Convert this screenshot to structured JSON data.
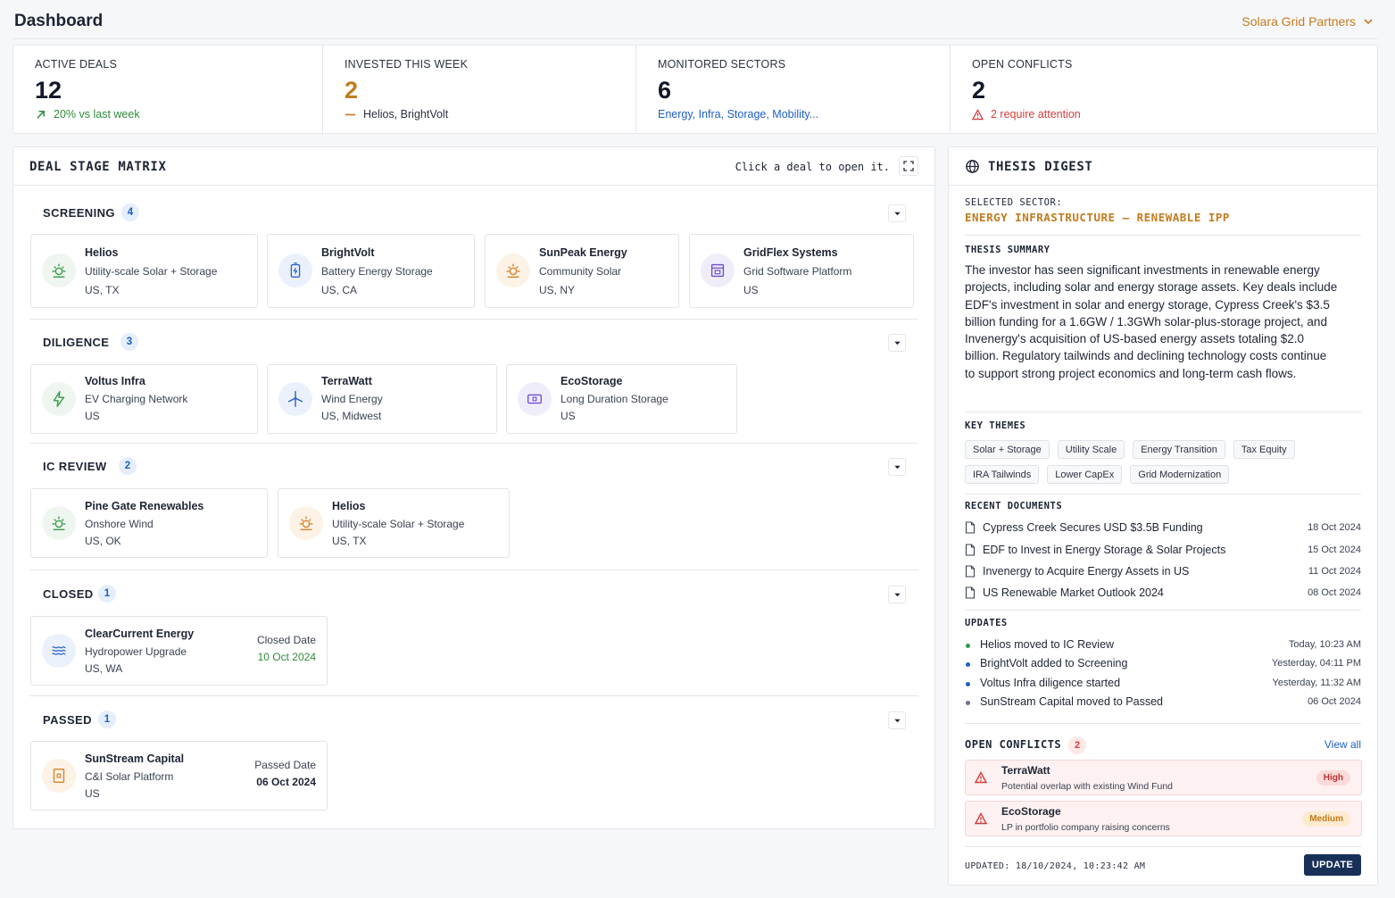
{
  "header": {
    "title": "Dashboard",
    "org": "Solara Grid Partners"
  },
  "stats": [
    {
      "label": "ACTIVE DEALS",
      "value": "12",
      "sub": "20% vs last week"
    },
    {
      "label": "INVESTED THIS WEEK",
      "value": "2",
      "sub": "Helios, BrightVolt"
    },
    {
      "label": "MONITORED SECTORS",
      "value": "6",
      "sub": "Energy, Infra, Storage, Mobility..."
    },
    {
      "label": "OPEN CONFLICTS",
      "value": "2",
      "sub": "2 require attention"
    }
  ],
  "matrix": {
    "title": "DEAL STAGE MATRIX",
    "hint": "Click a deal to open it.",
    "stages": [
      {
        "name": "SCREENING",
        "count": "4",
        "deals": [
          {
            "name": "Helios",
            "type": "Utility-scale Solar + Storage",
            "loc": "US, TX",
            "icon": "sun-icon"
          },
          {
            "name": "BrightVolt",
            "type": "Battery Energy Storage",
            "loc": "US, CA",
            "icon": "battery-icon"
          },
          {
            "name": "SunPeak Energy",
            "type": "Community Solar",
            "loc": "US, NY",
            "icon": "sun-icon"
          },
          {
            "name": "GridFlex Systems",
            "type": "Grid Software Platform",
            "loc": "US",
            "icon": "grid-icon"
          }
        ]
      },
      {
        "name": "DILIGENCE",
        "count": "3",
        "deals": [
          {
            "name": "Voltus Infra",
            "type": "EV Charging Network",
            "loc": "US",
            "icon": "bolt-icon"
          },
          {
            "name": "TerraWatt",
            "type": "Wind Energy",
            "loc": "US, Midwest",
            "icon": "wind-turbine-icon"
          },
          {
            "name": "EcoStorage",
            "type": "Long Duration Storage",
            "loc": "US",
            "icon": "storage-icon"
          }
        ]
      },
      {
        "name": "IC REVIEW",
        "count": "2",
        "deals": [
          {
            "name": "Pine Gate Renewables",
            "type": "Onshore Wind",
            "loc": "US, OK",
            "icon": "sun-icon"
          },
          {
            "name": "Helios",
            "type": "Utility-scale Solar + Storage",
            "loc": "US, TX",
            "icon": "sun-icon"
          }
        ]
      },
      {
        "name": "CLOSED",
        "count": "1",
        "deals": [
          {
            "name": "ClearCurrent Energy",
            "type": "Hydropower Upgrade",
            "loc": "US, WA",
            "date_label": "Closed Date",
            "date": "10 Oct 2024",
            "icon": "waves-icon"
          }
        ]
      },
      {
        "name": "PASSED",
        "count": "1",
        "deals": [
          {
            "name": "SunStream Capital",
            "type": "C&I Solar Platform",
            "loc": "US",
            "date_label": "Passed Date",
            "date": "06 Oct 2024",
            "icon": "solar-panel-icon"
          }
        ]
      }
    ]
  },
  "thesis": {
    "title": "THESIS DIGEST",
    "sector_label": "SELECTED SECTOR:",
    "sector": "ENERGY INFRASTRUCTURE – RENEWABLE IPP",
    "summary_label": "THESIS SUMMARY",
    "summary": "The investor has seen significant investments in renewable energy projects, including solar and energy storage assets. Key deals include EDF's investment in solar and energy storage, Cypress Creek's $3.5 billion funding for a 1.6GW / 1.3GWh solar-plus-storage project, and Invenergy's acquisition of US-based energy assets totaling $2.0 billion. Regulatory tailwinds and declining technology costs continue to support strong project economics and long-term cash flows.",
    "themes_label": "KEY THEMES",
    "themes": [
      "Solar + Storage",
      "Utility Scale",
      "Energy Transition",
      "Tax Equity",
      "IRA Tailwinds",
      "Lower CapEx",
      "Grid Modernization"
    ],
    "docs_label": "RECENT DOCUMENTS",
    "docs": [
      {
        "title": "Cypress Creek Secures USD $3.5B Funding",
        "date": "18 Oct 2024"
      },
      {
        "title": "EDF to Invest in Energy Storage & Solar Projects",
        "date": "15 Oct 2024"
      },
      {
        "title": "Invenergy to Acquire Energy Assets in US",
        "date": "11 Oct 2024"
      },
      {
        "title": "US Renewable Market Outlook 2024",
        "date": "08 Oct 2024"
      }
    ],
    "updates_label": "UPDATES",
    "updates": [
      {
        "text": "Helios moved to IC Review",
        "time": "Today, 10:23 AM",
        "color": "#2f9a48"
      },
      {
        "text": "BrightVolt added to Screening",
        "time": "Yesterday, 04:11 PM",
        "color": "#1d5fc4"
      },
      {
        "text": "Voltus Infra diligence started",
        "time": "Yesterday, 11:32 AM",
        "color": "#1d5fc4"
      },
      {
        "text": "SunStream Capital moved to Passed",
        "time": "06 Oct 2024",
        "color": "#6b7280"
      }
    ],
    "conflicts_label": "OPEN CONFLICTS",
    "conflicts_count": "2",
    "view_all": "View all",
    "conflicts": [
      {
        "name": "TerraWatt",
        "desc": "Potential overlap with existing Wind Fund",
        "severity": "High"
      },
      {
        "name": "EcoStorage",
        "desc": "LP in portfolio company raising concerns",
        "severity": "Medium"
      }
    ],
    "updated": "UPDATED: 18/10/2024, 10:23:42 AM",
    "update_button": "UPDATE"
  },
  "colors": {
    "accent": "#c47b1e",
    "primary": "#183058",
    "link": "#1d5fc4",
    "positive": "#2f8a3b",
    "danger": "#d43c3c"
  }
}
